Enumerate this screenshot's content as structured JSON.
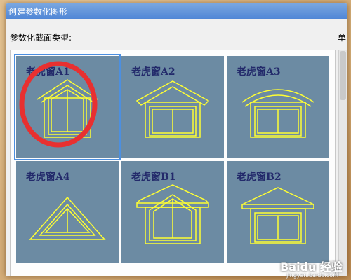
{
  "window": {
    "title": "创建参数化图形"
  },
  "section": {
    "label": "参数化截面类型:",
    "right_label": "单"
  },
  "tiles": [
    {
      "label": "老虎窗A1",
      "selected": true
    },
    {
      "label": "老虎窗A2",
      "selected": false
    },
    {
      "label": "老虎窗A3",
      "selected": false
    },
    {
      "label": "老虎窗A4",
      "selected": false
    },
    {
      "label": "老虎窗B1",
      "selected": false
    },
    {
      "label": "老虎窗B2",
      "selected": false
    }
  ],
  "watermark": {
    "text": "Baidu 经验",
    "sub": "jingyan.baidu.com"
  },
  "colors": {
    "tile_bg": "#6c8ba3",
    "shape": "#ffff33",
    "label": "#232a6b",
    "selection": "#4c8fe0",
    "annotation": "#e83030"
  }
}
